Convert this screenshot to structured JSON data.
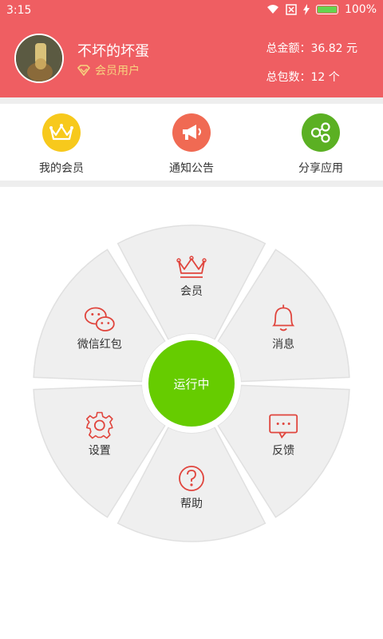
{
  "status_bar": {
    "time": "3:15",
    "battery": "100%",
    "battery_level": 1.0
  },
  "profile": {
    "username": "不坏的坏蛋",
    "member_type": "会员用户",
    "total_amount": "总金额：36.82 元",
    "total_packets": "总包数：12 个"
  },
  "quick_actions": [
    {
      "label": "我的会员",
      "icon": "crown-icon",
      "color": "#f7c91c"
    },
    {
      "label": "通知公告",
      "icon": "megaphone-icon",
      "color": "#f06a53"
    },
    {
      "label": "分享应用",
      "icon": "share-icon",
      "color": "#5bb023"
    }
  ],
  "wheel": {
    "center_label": "运行中",
    "center_color": "#66cc00",
    "accent_color": "#e0453d",
    "segments": [
      {
        "label": "会员",
        "icon": "crown-icon"
      },
      {
        "label": "消息",
        "icon": "bell-icon"
      },
      {
        "label": "反馈",
        "icon": "chat-icon"
      },
      {
        "label": "帮助",
        "icon": "help-icon"
      },
      {
        "label": "设置",
        "icon": "gear-icon"
      },
      {
        "label": "微信红包",
        "icon": "wechat-icon"
      }
    ]
  }
}
